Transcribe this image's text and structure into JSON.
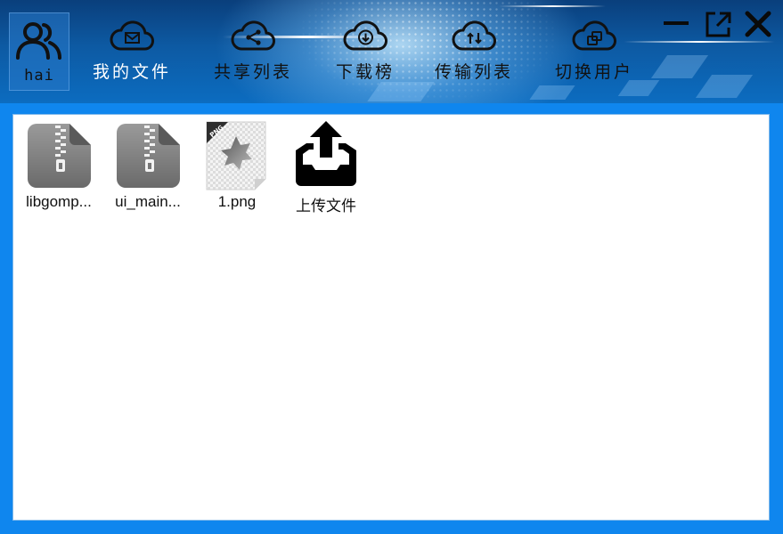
{
  "user": {
    "name": "hai",
    "icon": "users-icon"
  },
  "nav": [
    {
      "label": "我的文件",
      "icon": "cloud-mail-icon"
    },
    {
      "label": "共享列表",
      "icon": "cloud-share-icon"
    },
    {
      "label": "下载榜",
      "icon": "cloud-download-icon"
    },
    {
      "label": "传输列表",
      "icon": "cloud-transfer-icon"
    },
    {
      "label": "切换用户",
      "icon": "cloud-switch-icon"
    }
  ],
  "window_controls": [
    "minimize-icon",
    "popout-icon",
    "close-icon"
  ],
  "files": [
    {
      "name": "libgomp...",
      "icon": "zip-file-icon"
    },
    {
      "name": "ui_main...",
      "icon": "zip-file-icon"
    },
    {
      "name": "1.png",
      "icon": "png-file-icon",
      "badge": "PNG"
    },
    {
      "name": "上传文件",
      "icon": "upload-icon"
    }
  ],
  "colors": {
    "accent": "#0f86ee",
    "header_dark": "#0a3f7c",
    "content_bg": "#ffffff",
    "active_nav_text": "#ffffff"
  }
}
